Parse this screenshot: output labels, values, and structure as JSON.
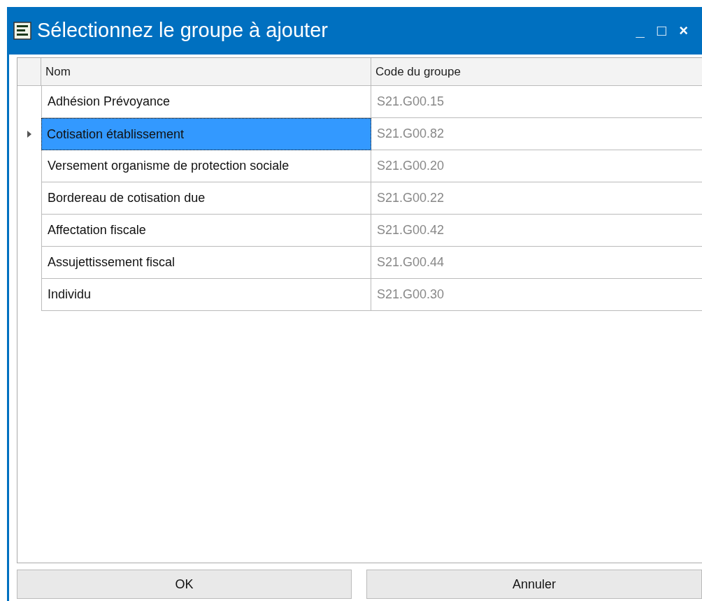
{
  "window": {
    "title": "Sélectionnez le groupe à ajouter",
    "controls": [
      "_",
      "□",
      "×"
    ]
  },
  "table": {
    "columns": [
      "Nom",
      "Code du groupe"
    ],
    "rows": [
      {
        "name": "Adhésion Prévoyance",
        "code": "S21.G00.15",
        "selected": false
      },
      {
        "name": "Cotisation établissement",
        "code": "S21.G00.82",
        "selected": true
      },
      {
        "name": "Versement organisme de protection sociale",
        "code": "S21.G00.20",
        "selected": false
      },
      {
        "name": "Bordereau de cotisation due",
        "code": "S21.G00.22",
        "selected": false
      },
      {
        "name": "Affectation fiscale",
        "code": "S21.G00.42",
        "selected": false
      },
      {
        "name": "Assujettissement fiscal",
        "code": "S21.G00.44",
        "selected": false
      },
      {
        "name": "Individu",
        "code": "S21.G00.30",
        "selected": false
      }
    ]
  },
  "buttons": [
    "OK",
    "Annuler"
  ]
}
